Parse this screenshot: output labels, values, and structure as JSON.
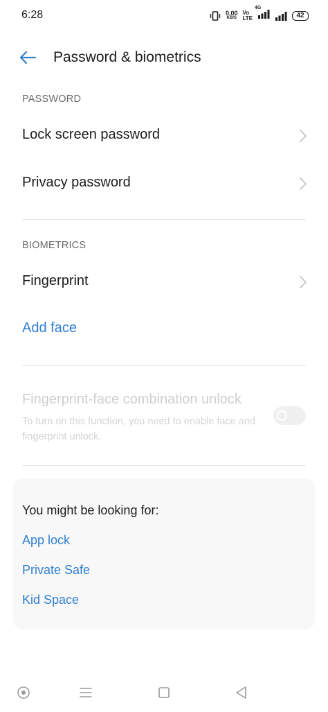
{
  "status_bar": {
    "time": "6:28",
    "speed_value": "0.00",
    "speed_unit": "KB/S",
    "volte_top": "Vo",
    "volte_bottom": "LTE",
    "network": "4G",
    "battery": "42"
  },
  "header": {
    "title": "Password & biometrics",
    "back_icon": "back-arrow-icon"
  },
  "password_section": {
    "header": "PASSWORD",
    "items": [
      {
        "label": "Lock screen password"
      },
      {
        "label": "Privacy password"
      }
    ]
  },
  "biometrics_section": {
    "header": "BIOMETRICS",
    "fingerprint_label": "Fingerprint",
    "add_face_label": "Add face"
  },
  "combination": {
    "title": "Fingerprint-face combination unlock",
    "description": "To turn on this function, you need to enable face and fingerprint unlock.",
    "enabled": false
  },
  "suggestions": {
    "title": "You might be looking for:",
    "links": [
      "App lock",
      "Private Safe",
      "Kid Space"
    ]
  },
  "nav_bar": {
    "icons": [
      "assistant-icon",
      "menu-icon",
      "home-icon",
      "back-icon"
    ]
  },
  "colors": {
    "accent": "#2f7fd1",
    "text": "#1b1b1b",
    "section_header": "#6b6b6b",
    "disabled": "#cfcfcf"
  }
}
